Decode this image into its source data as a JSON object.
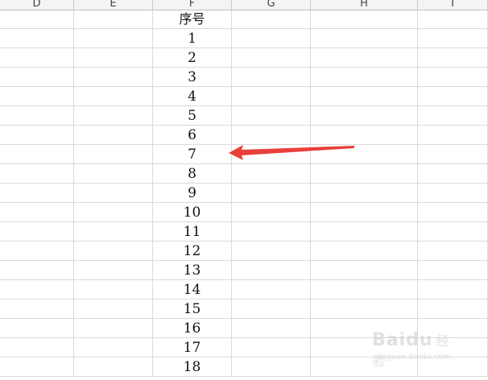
{
  "columns": [
    "D",
    "E",
    "F",
    "G",
    "H",
    "I"
  ],
  "table": {
    "header": "序号",
    "values": [
      "1",
      "2",
      "3",
      "4",
      "5",
      "6",
      "7",
      "8",
      "9",
      "10",
      "11",
      "12",
      "13",
      "14",
      "15",
      "16",
      "17",
      "18"
    ]
  },
  "watermark": {
    "brand": "Baidu",
    "cn": "经验",
    "sub": "jingyan.baidu.com"
  },
  "colors": {
    "arrow": "#e8403a",
    "grid": "#dadada",
    "header_bg": "#f4f4f4"
  },
  "icons": [
    "red-arrow-annotation",
    "baidu-paw-logo"
  ]
}
